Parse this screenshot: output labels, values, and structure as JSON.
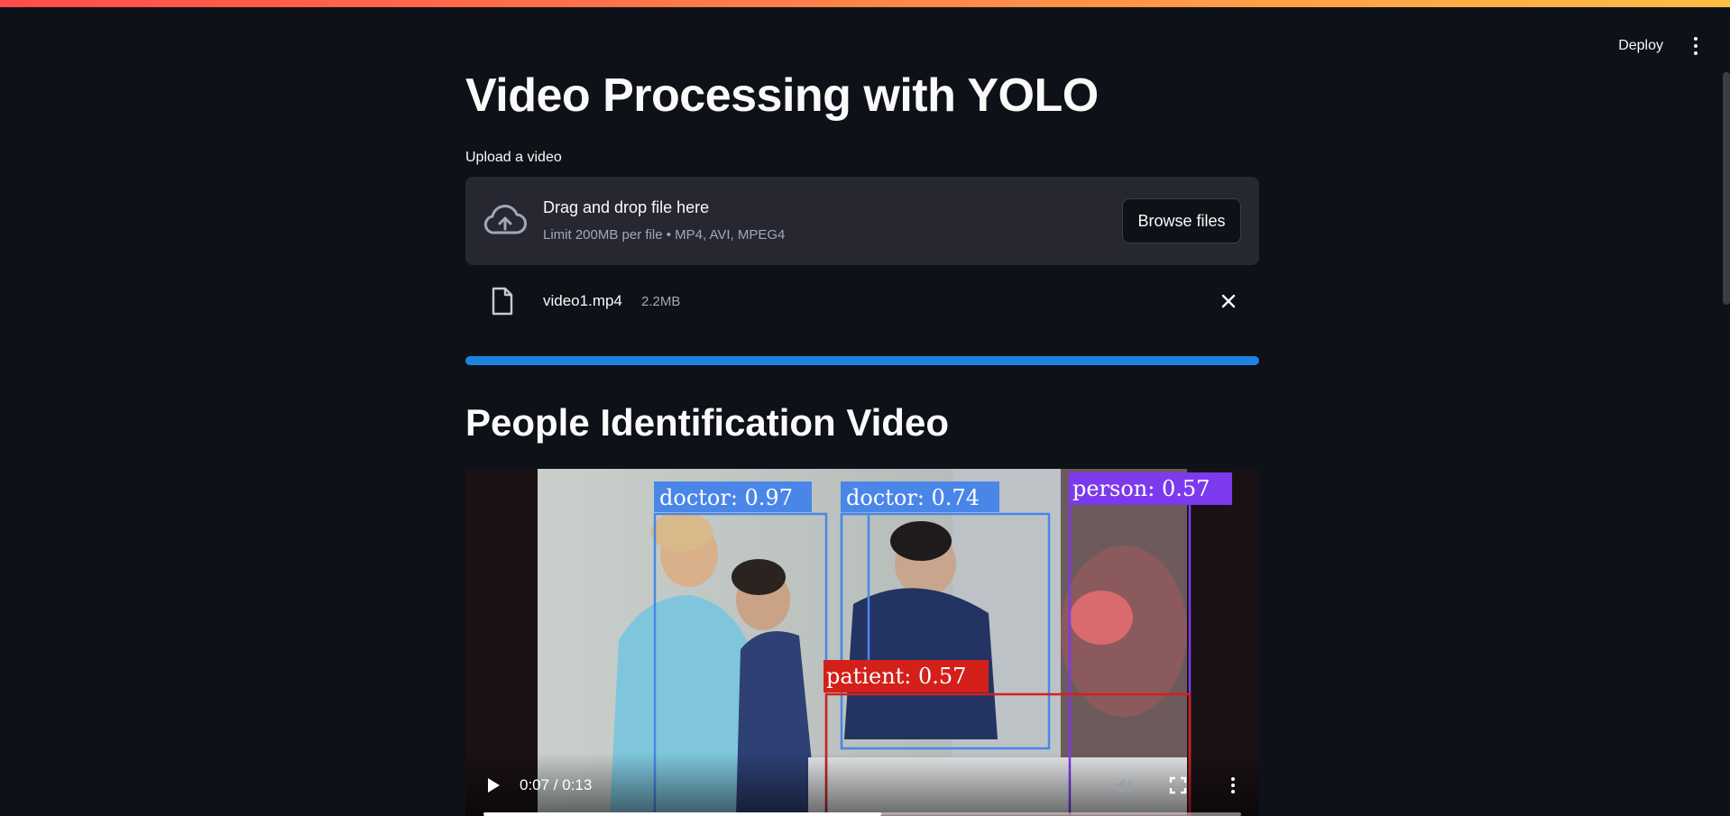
{
  "header": {
    "deploy_label": "Deploy",
    "menu_icon": "kebab-menu-icon"
  },
  "main": {
    "title": "Video Processing with YOLO",
    "uploader": {
      "label": "Upload a video",
      "dropzone_title": "Drag and drop file here",
      "dropzone_limit": "Limit 200MB per file • MP4, AVI, MPEG4",
      "browse_label": "Browse files",
      "icon": "cloud-upload-icon"
    },
    "file": {
      "name": "video1.mp4",
      "size": "2.2MB",
      "icon": "file-icon"
    },
    "progress": {
      "fraction": 1.0,
      "color": "#1c83e1"
    },
    "section_title": "People Identification Video"
  },
  "video": {
    "time_display": "0:07 / 0:13",
    "position_fraction": 0.525,
    "detections": [
      {
        "label": "doctor: 0.97",
        "color": "#4a86e8"
      },
      {
        "label": "doctor: 0.74",
        "color": "#4a86e8"
      },
      {
        "label": "person: 0.57",
        "color": "#7c3aed"
      },
      {
        "label": "patient: 0.57",
        "color": "#d3201a"
      }
    ]
  },
  "colors": {
    "accent": "#ff4b4b",
    "accent_end": "#ffbd45",
    "background": "#0e1117",
    "surface": "#262730"
  }
}
